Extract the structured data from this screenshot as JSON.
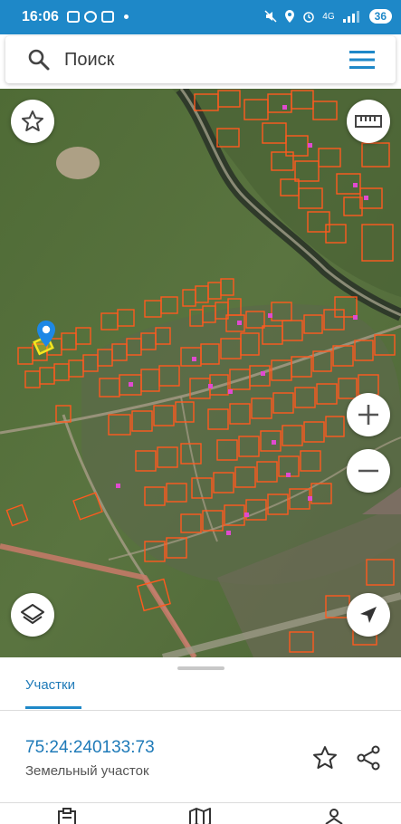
{
  "status_bar": {
    "time": "16:06",
    "network_label": "4G",
    "battery": "36",
    "icons": [
      "message-icon",
      "whatsapp-icon",
      "youtube-icon",
      "dot-icon",
      "mute-icon",
      "location-icon",
      "alarm-icon",
      "signal-icon"
    ]
  },
  "search": {
    "placeholder": "Поиск",
    "icon": "search-icon",
    "menu_icon": "hamburger-menu-icon"
  },
  "map": {
    "controls": {
      "favorites": "star-icon",
      "ruler": "ruler-icon",
      "zoom_in": "plus-icon",
      "zoom_out": "minus-icon",
      "layers": "layers-icon",
      "my_location": "navigation-arrow-icon"
    },
    "marker_icon": "location-pin-icon",
    "colors": {
      "parcel_outline": "#ff5a1e",
      "selected_parcel": "#f5e61e",
      "marker": "#1e88e5"
    }
  },
  "bottom_sheet": {
    "tab_label": "Участки",
    "parcel_number": "75:24:240133:73",
    "parcel_type": "Земельный участок",
    "actions": [
      "star-outline-icon",
      "share-icon"
    ]
  },
  "bottom_nav": {
    "icons": [
      "clipboard-icon",
      "map-icon",
      "route-icon"
    ]
  },
  "colors": {
    "accent": "#1e88c8",
    "text_link": "#1e7ab8"
  }
}
